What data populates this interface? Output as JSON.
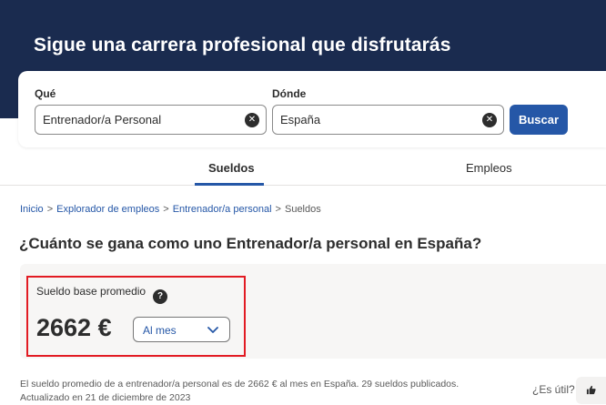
{
  "hero": {
    "title": "Sigue una carrera profesional que disfrutarás"
  },
  "search": {
    "what_label": "Qué",
    "what_value": "Entrenador/a Personal",
    "where_label": "Dónde",
    "where_value": "España",
    "clear_glyph": "✕",
    "button_label": "Buscar"
  },
  "tabs": [
    {
      "label": "Sueldos",
      "active": true
    },
    {
      "label": "Empleos",
      "active": false
    }
  ],
  "breadcrumb": {
    "items": [
      "Inicio",
      "Explorador de empleos",
      "Entrenador/a personal",
      "Sueldos"
    ],
    "separator": ">"
  },
  "page": {
    "title": "¿Cuánto se gana como uno Entrenador/a personal en España?"
  },
  "salary": {
    "label": "Sueldo base promedio",
    "help_glyph": "?",
    "value": "2662 €",
    "period": "Al mes"
  },
  "footnote": {
    "line1": "El sueldo promedio de a entrenador/a personal es de 2662 € al mes en España.  29 sueldos publicados.",
    "line2": "Actualizado en 21 de diciembre de 2023"
  },
  "feedback": {
    "question": "¿Es útil?",
    "icon": "thumbs-up-icon"
  },
  "colors": {
    "hero_bg": "#1a2b4f",
    "primary": "#2557a7",
    "highlight": "#e21b23",
    "panel_bg": "#f7f6f5"
  }
}
